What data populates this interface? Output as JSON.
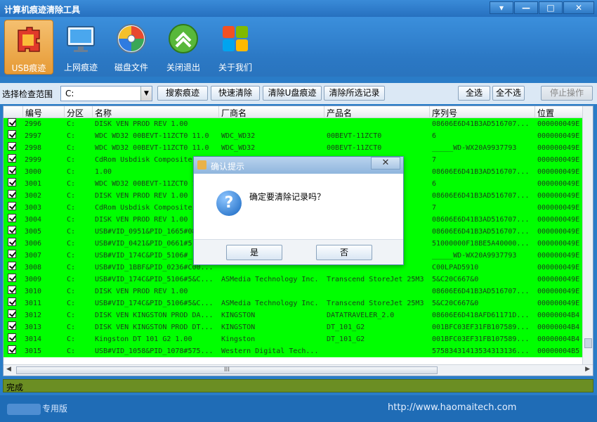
{
  "window": {
    "title": "计算机痕迹清除工具",
    "controls": [
      "▾",
      "—",
      "□",
      "✕"
    ]
  },
  "toolbar_top": [
    {
      "label": "USB痕迹",
      "icon": "usb-puzzle-icon",
      "active": true
    },
    {
      "label": "上网痕迹",
      "icon": "monitor-web-icon",
      "active": false
    },
    {
      "label": "磁盘文件",
      "icon": "disk-files-icon",
      "active": false
    },
    {
      "label": "关闭退出",
      "icon": "exit-arrow-icon",
      "active": false
    },
    {
      "label": "关于我们",
      "icon": "about-windows-icon",
      "active": false
    }
  ],
  "scan_bar": {
    "label": "选择检查范围",
    "range_value": "C:",
    "buttons": {
      "search": "搜索痕迹",
      "quick_clean": "快速清除",
      "clean_usb": "清除U盘痕迹",
      "clean_selected": "清除所选记录",
      "select_all": "全选",
      "select_none": "全不选",
      "stop": "停止操作"
    }
  },
  "table": {
    "columns": [
      "编号",
      "分区",
      "名称",
      "厂商名",
      "产品名",
      "序列号",
      "位置"
    ],
    "rows": [
      {
        "id": "2996",
        "drive": "C:",
        "name": "DISK VEN PROD REV 1.00",
        "vendor": "",
        "product": "",
        "serial": "08606E6D41B3AD516707...",
        "loc": "000000049E"
      },
      {
        "id": "2997",
        "drive": "C:",
        "name": "WDC WD32 00BEVT-11ZCT0 11.0",
        "vendor": "WDC_WD32",
        "product": "00BEVT-11ZCT0",
        "serial": "6",
        "loc": "000000049E"
      },
      {
        "id": "2998",
        "drive": "C:",
        "name": "WDC WD32 00BEVT-11ZCT0 11.0",
        "vendor": "WDC_WD32",
        "product": "00BEVT-11ZCT0",
        "serial": "_____WD-WX20A9937793",
        "loc": "000000049E"
      },
      {
        "id": "2999",
        "drive": "C:",
        "name": "CdRom Usbdisk Composite",
        "vendor": "",
        "product": "",
        "serial": "7",
        "loc": "000000049E"
      },
      {
        "id": "3000",
        "drive": "C:",
        "name": "1.00",
        "vendor": "",
        "product": "",
        "serial": "08606E6D41B3AD516707...",
        "loc": "000000049E"
      },
      {
        "id": "3001",
        "drive": "C:",
        "name": "WDC WD32 00BEVT-11ZCT0 1",
        "vendor": "",
        "product": "",
        "serial": "6",
        "loc": "000000049E"
      },
      {
        "id": "3002",
        "drive": "C:",
        "name": "DISK VEN PROD REV 1.00",
        "vendor": "",
        "product": "",
        "serial": "08606E6D41B3AD516707...",
        "loc": "000000049E"
      },
      {
        "id": "3003",
        "drive": "C:",
        "name": "CdRom Usbdisk Composite",
        "vendor": "",
        "product": "",
        "serial": "7",
        "loc": "000000049E"
      },
      {
        "id": "3004",
        "drive": "C:",
        "name": "DISK VEN PROD REV 1.00",
        "vendor": "",
        "product": "",
        "serial": "08606E6D41B3AD516707...",
        "loc": "000000049E"
      },
      {
        "id": "3005",
        "drive": "C:",
        "name": "USB#VID_0951&PID_1665#08",
        "vendor": "",
        "product": "",
        "serial": "08606E6D41B3AD516707...",
        "loc": "000000049E"
      },
      {
        "id": "3006",
        "drive": "C:",
        "name": "USB#VID_0421&PID_0661#5",
        "vendor": "",
        "product": "",
        "serial": "51000000F18BE5A40000...",
        "loc": "000000049E"
      },
      {
        "id": "3007",
        "drive": "C:",
        "name": "USB#VID_174C&PID_5106#_",
        "vendor": "",
        "product": "25M3",
        "serial": "_____WD-WX20A9937793",
        "loc": "000000049E"
      },
      {
        "id": "3008",
        "drive": "C:",
        "name": "USB#VID_1BBF&PID_0236#C00...",
        "vendor": "",
        "product": "",
        "serial": "C00LPAD5910",
        "loc": "000000049E"
      },
      {
        "id": "3009",
        "drive": "C:",
        "name": "USB#VID_174C&PID_5106#5&C...",
        "vendor": "ASMedia Technology Inc.",
        "product": "Transcend StoreJet 25M3",
        "serial": "5&C20C667&0",
        "loc": "000000049E"
      },
      {
        "id": "3010",
        "drive": "C:",
        "name": "DISK VEN PROD REV 1.00",
        "vendor": "",
        "product": "",
        "serial": "08606E6D41B3AD516707...",
        "loc": "000000049E"
      },
      {
        "id": "3011",
        "drive": "C:",
        "name": "USB#VID_174C&PID_5106#5&C...",
        "vendor": "ASMedia Technology Inc.",
        "product": "Transcend StoreJet 25M3",
        "serial": "5&C20C667&0",
        "loc": "000000049E"
      },
      {
        "id": "3012",
        "drive": "C:",
        "name": "DISK VEN KINGSTON PROD DA...",
        "vendor": "KINGSTON",
        "product": "DATATRAVELER_2.0",
        "serial": "08606E6D418AFD61171D...",
        "loc": "00000004B4"
      },
      {
        "id": "3013",
        "drive": "C:",
        "name": "DISK VEN KINGSTON PROD DT...",
        "vendor": "KINGSTON",
        "product": "DT_101_G2",
        "serial": "001BFC03EF31FB107589...",
        "loc": "00000004B4"
      },
      {
        "id": "3014",
        "drive": "C:",
        "name": "Kingston DT 101 G2 1.00",
        "vendor": "Kingston",
        "product": "DT_101_G2",
        "serial": "001BFC03EF31FB107589...",
        "loc": "00000004B4"
      },
      {
        "id": "3015",
        "drive": "C:",
        "name": "USB#VID_1058&PID_1078#575...",
        "vendor": "Western Digital Tech...",
        "product": "",
        "serial": "57583431413534313136...",
        "loc": "00000004B5"
      }
    ],
    "hscroll_grip": "III"
  },
  "status": {
    "text": "完成"
  },
  "footer": {
    "edition": "专用版",
    "url": "http://www.haomaitech.com"
  },
  "dialog": {
    "title": "确认提示",
    "close": "✕",
    "icon": "question-icon",
    "message": "确定要清除记录吗？",
    "yes": "是",
    "no": "否"
  },
  "colors": {
    "row_bg": "#00ff00",
    "status_bg": "#6b8e23",
    "accent": "#2a7cc7"
  }
}
